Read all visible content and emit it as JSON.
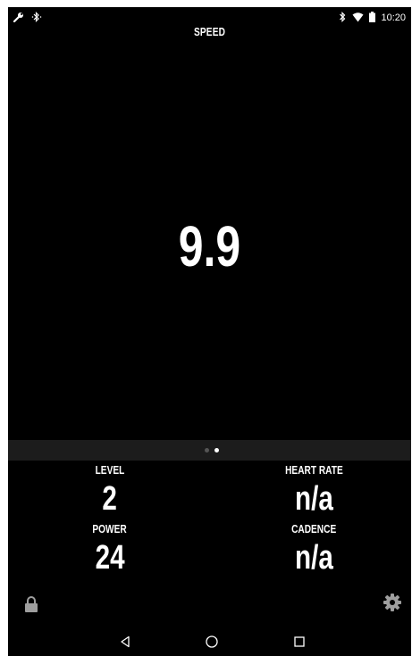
{
  "status_bar": {
    "time": "10:20",
    "icons": [
      "wrench-icon",
      "bluetooth-searching-icon",
      "bluetooth-icon",
      "wifi-icon",
      "battery-icon"
    ]
  },
  "main_metric": {
    "label": "SPEED",
    "value": "9.9"
  },
  "pager": {
    "page_count": 2,
    "active_index": 1
  },
  "stats": {
    "level": {
      "label": "LEVEL",
      "value": "2"
    },
    "heart_rate": {
      "label": "HEART RATE",
      "value": "n/a"
    },
    "power": {
      "label": "POWER",
      "value": "24"
    },
    "cadence": {
      "label": "CADENCE",
      "value": "n/a"
    }
  },
  "bottom_icons": {
    "left": "lock-icon",
    "right": "gear-icon"
  },
  "nav_bar": {
    "buttons": [
      "back-icon",
      "home-icon",
      "recents-icon"
    ]
  },
  "colors": {
    "background": "#000000",
    "text": "#ffffff",
    "pager_bg": "#1c1c1c",
    "icon_gray": "#9e9e9e"
  }
}
